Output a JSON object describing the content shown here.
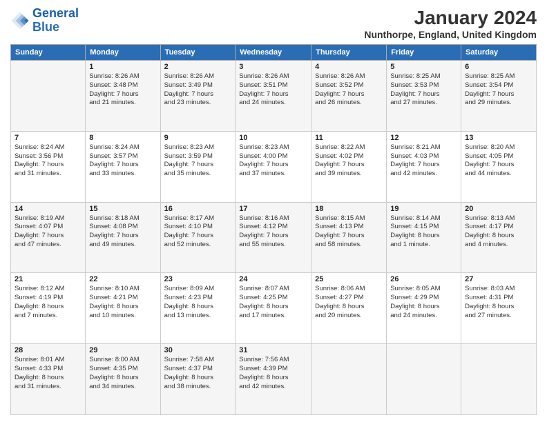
{
  "header": {
    "logo_line1": "General",
    "logo_line2": "Blue",
    "month_year": "January 2024",
    "location": "Nunthorpe, England, United Kingdom"
  },
  "days_of_week": [
    "Sunday",
    "Monday",
    "Tuesday",
    "Wednesday",
    "Thursday",
    "Friday",
    "Saturday"
  ],
  "weeks": [
    [
      {
        "day": "",
        "info": ""
      },
      {
        "day": "1",
        "info": "Sunrise: 8:26 AM\nSunset: 3:48 PM\nDaylight: 7 hours\nand 21 minutes."
      },
      {
        "day": "2",
        "info": "Sunrise: 8:26 AM\nSunset: 3:49 PM\nDaylight: 7 hours\nand 23 minutes."
      },
      {
        "day": "3",
        "info": "Sunrise: 8:26 AM\nSunset: 3:51 PM\nDaylight: 7 hours\nand 24 minutes."
      },
      {
        "day": "4",
        "info": "Sunrise: 8:26 AM\nSunset: 3:52 PM\nDaylight: 7 hours\nand 26 minutes."
      },
      {
        "day": "5",
        "info": "Sunrise: 8:25 AM\nSunset: 3:53 PM\nDaylight: 7 hours\nand 27 minutes."
      },
      {
        "day": "6",
        "info": "Sunrise: 8:25 AM\nSunset: 3:54 PM\nDaylight: 7 hours\nand 29 minutes."
      }
    ],
    [
      {
        "day": "7",
        "info": "Sunrise: 8:24 AM\nSunset: 3:56 PM\nDaylight: 7 hours\nand 31 minutes."
      },
      {
        "day": "8",
        "info": "Sunrise: 8:24 AM\nSunset: 3:57 PM\nDaylight: 7 hours\nand 33 minutes."
      },
      {
        "day": "9",
        "info": "Sunrise: 8:23 AM\nSunset: 3:59 PM\nDaylight: 7 hours\nand 35 minutes."
      },
      {
        "day": "10",
        "info": "Sunrise: 8:23 AM\nSunset: 4:00 PM\nDaylight: 7 hours\nand 37 minutes."
      },
      {
        "day": "11",
        "info": "Sunrise: 8:22 AM\nSunset: 4:02 PM\nDaylight: 7 hours\nand 39 minutes."
      },
      {
        "day": "12",
        "info": "Sunrise: 8:21 AM\nSunset: 4:03 PM\nDaylight: 7 hours\nand 42 minutes."
      },
      {
        "day": "13",
        "info": "Sunrise: 8:20 AM\nSunset: 4:05 PM\nDaylight: 7 hours\nand 44 minutes."
      }
    ],
    [
      {
        "day": "14",
        "info": "Sunrise: 8:19 AM\nSunset: 4:07 PM\nDaylight: 7 hours\nand 47 minutes."
      },
      {
        "day": "15",
        "info": "Sunrise: 8:18 AM\nSunset: 4:08 PM\nDaylight: 7 hours\nand 49 minutes."
      },
      {
        "day": "16",
        "info": "Sunrise: 8:17 AM\nSunset: 4:10 PM\nDaylight: 7 hours\nand 52 minutes."
      },
      {
        "day": "17",
        "info": "Sunrise: 8:16 AM\nSunset: 4:12 PM\nDaylight: 7 hours\nand 55 minutes."
      },
      {
        "day": "18",
        "info": "Sunrise: 8:15 AM\nSunset: 4:13 PM\nDaylight: 7 hours\nand 58 minutes."
      },
      {
        "day": "19",
        "info": "Sunrise: 8:14 AM\nSunset: 4:15 PM\nDaylight: 8 hours\nand 1 minute."
      },
      {
        "day": "20",
        "info": "Sunrise: 8:13 AM\nSunset: 4:17 PM\nDaylight: 8 hours\nand 4 minutes."
      }
    ],
    [
      {
        "day": "21",
        "info": "Sunrise: 8:12 AM\nSunset: 4:19 PM\nDaylight: 8 hours\nand 7 minutes."
      },
      {
        "day": "22",
        "info": "Sunrise: 8:10 AM\nSunset: 4:21 PM\nDaylight: 8 hours\nand 10 minutes."
      },
      {
        "day": "23",
        "info": "Sunrise: 8:09 AM\nSunset: 4:23 PM\nDaylight: 8 hours\nand 13 minutes."
      },
      {
        "day": "24",
        "info": "Sunrise: 8:07 AM\nSunset: 4:25 PM\nDaylight: 8 hours\nand 17 minutes."
      },
      {
        "day": "25",
        "info": "Sunrise: 8:06 AM\nSunset: 4:27 PM\nDaylight: 8 hours\nand 20 minutes."
      },
      {
        "day": "26",
        "info": "Sunrise: 8:05 AM\nSunset: 4:29 PM\nDaylight: 8 hours\nand 24 minutes."
      },
      {
        "day": "27",
        "info": "Sunrise: 8:03 AM\nSunset: 4:31 PM\nDaylight: 8 hours\nand 27 minutes."
      }
    ],
    [
      {
        "day": "28",
        "info": "Sunrise: 8:01 AM\nSunset: 4:33 PM\nDaylight: 8 hours\nand 31 minutes."
      },
      {
        "day": "29",
        "info": "Sunrise: 8:00 AM\nSunset: 4:35 PM\nDaylight: 8 hours\nand 34 minutes."
      },
      {
        "day": "30",
        "info": "Sunrise: 7:58 AM\nSunset: 4:37 PM\nDaylight: 8 hours\nand 38 minutes."
      },
      {
        "day": "31",
        "info": "Sunrise: 7:56 AM\nSunset: 4:39 PM\nDaylight: 8 hours\nand 42 minutes."
      },
      {
        "day": "",
        "info": ""
      },
      {
        "day": "",
        "info": ""
      },
      {
        "day": "",
        "info": ""
      }
    ]
  ]
}
